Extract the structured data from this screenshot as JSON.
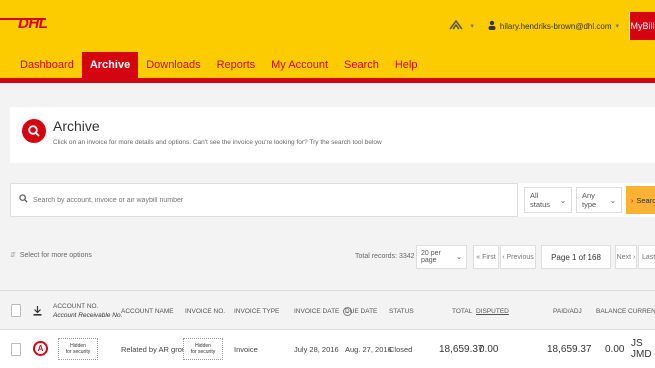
{
  "header": {
    "logo": "DHL",
    "user_email": "hilary.hendriks-brown@dhl.com",
    "mybill_label": "MyBill",
    "nav": [
      "Dashboard",
      "Archive",
      "Downloads",
      "Reports",
      "My Account",
      "Search",
      "Help"
    ],
    "active_nav": "Archive",
    "icons": {
      "apps": "network-icon",
      "user": "user-icon",
      "chevron": "chevron-down-icon"
    }
  },
  "archive": {
    "title": "Archive",
    "description": "Click on an invoice for more details and options. Can't see the invoice you're looking for? Try the search tool below"
  },
  "search": {
    "placeholder": "Search by account, invoice or air waybill number",
    "status_value": "All status",
    "type_value": "Any type",
    "button_label": "Search"
  },
  "toolbar": {
    "select_options": "Select for more options",
    "total_records": "Total records: 3342",
    "per_page": "20 per page",
    "first": "« First",
    "previous": "‹ Previous",
    "page_indicator": "Page 1 of 168",
    "next": "Next ›",
    "last": "Last »"
  },
  "table": {
    "headers": {
      "account_no": "ACCOUNT NO.",
      "account_receivable": "Account Receivable No.",
      "account_name": "ACCOUNT NAME",
      "invoice_no": "INVOICE NO.",
      "invoice_type": "INVOICE TYPE",
      "invoice_date": "INVOICE DATE",
      "due_date": "DUE DATE",
      "status": "STATUS",
      "total": "TOTAL",
      "disputed": "DISPUTED",
      "paid_adj": "PAID/ADJ",
      "balance": "BALANCE",
      "currency": "CURRENC"
    },
    "rows": [
      {
        "hidden_1a": "Hidden",
        "hidden_1b": "for security",
        "account_name": "Related by AR group",
        "hidden_2a": "Hidden",
        "hidden_2b": "for security",
        "invoice_type": "Invoice",
        "invoice_date": "July 28, 2016",
        "due_date": "Aug. 27, 2016",
        "status": "Closed",
        "total": "18,659.37",
        "disputed": "0.00",
        "paid_adj": "18,659.37",
        "balance": "0.00",
        "currency": "JS JMD"
      }
    ]
  },
  "colors": {
    "brand_yellow": "#fdcc00",
    "brand_red": "#d40511",
    "search_button": "#f9b234"
  }
}
